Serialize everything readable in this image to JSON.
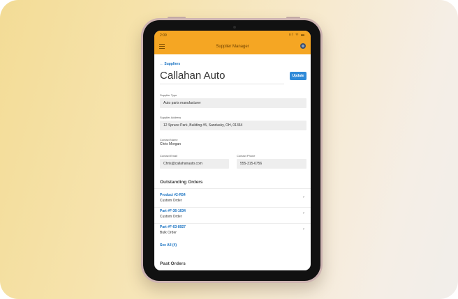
{
  "status": {
    "time": "2:09",
    "icons": "ııl ᯤ ▬"
  },
  "appbar": {
    "title": "Supplier Manager"
  },
  "nav": {
    "back_label": "← Suppliers"
  },
  "supplier": {
    "name": "Callahan Auto",
    "update_label": "Update",
    "type_label": "Supplier Type",
    "type_value": "Auto parts manufacturer",
    "address_label": "Supplier Address",
    "address_value": "12 Spruce Park, Building #5, Sandusky, OH, 01364",
    "contact_name_label": "Contact Name",
    "contact_name_value": "Chris Morgan",
    "contact_email_label": "Contact Email",
    "contact_email_value": "Chris@callahanauto.com",
    "contact_phone_label": "Contact Phone",
    "contact_phone_value": "555-315-6756"
  },
  "outstanding": {
    "heading": "Outstanding Orders",
    "orders": [
      {
        "name": "Product #2-R54",
        "type": "Custom Order"
      },
      {
        "name": "Part #F-36-1634",
        "type": "Custom Order"
      },
      {
        "name": "Part #F-63-8927",
        "type": "Bulk Order"
      }
    ],
    "see_all": "See All (4)"
  },
  "past": {
    "heading": "Past Orders"
  },
  "icons": {
    "menu": "menu-icon",
    "profile": "profile-icon",
    "chevron": "chevron-right-icon",
    "chevron_glyph": "›"
  },
  "colors": {
    "accent": "#f5a623",
    "link": "#1a73c2",
    "button": "#2f8ad8"
  }
}
